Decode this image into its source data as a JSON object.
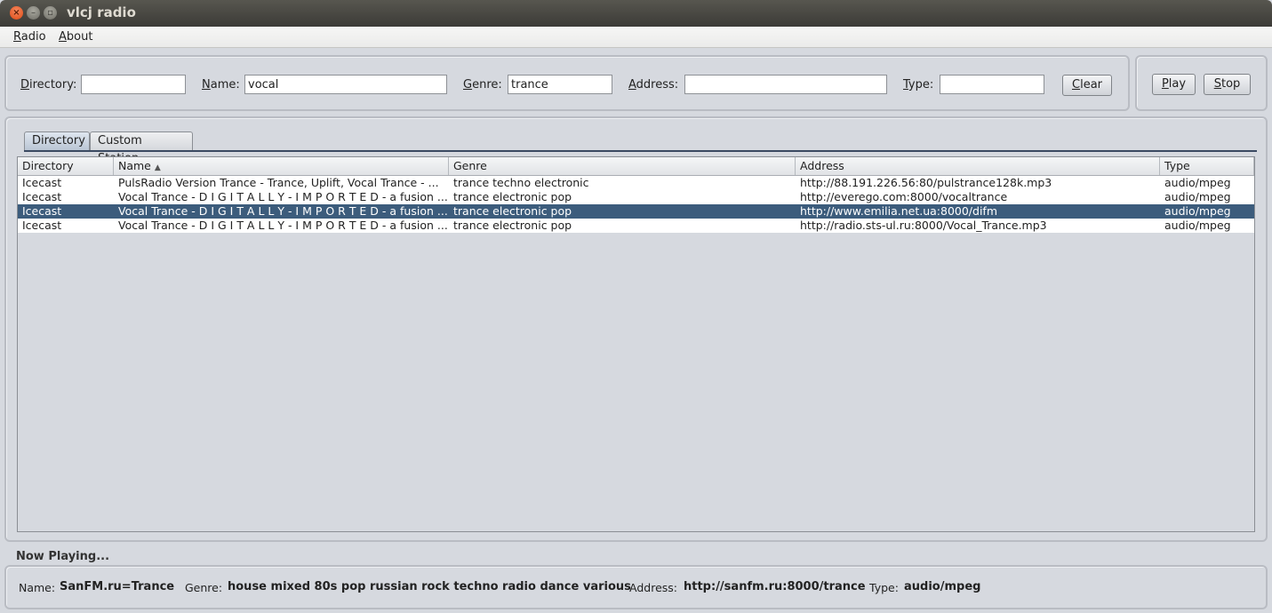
{
  "window": {
    "title": "vlcj radio",
    "close_glyph": "×",
    "min_glyph": "–",
    "max_glyph": "▫"
  },
  "menu": [
    {
      "mnemonic": "R",
      "rest": "adio"
    },
    {
      "mnemonic": "A",
      "rest": "bout"
    }
  ],
  "search": {
    "directory": {
      "mnemonic": "D",
      "rest": "irectory:",
      "value": ""
    },
    "name": {
      "mnemonic": "N",
      "rest": "ame:",
      "value": "vocal"
    },
    "genre": {
      "mnemonic": "G",
      "rest": "enre:",
      "value": "trance"
    },
    "address": {
      "mnemonic": "A",
      "rest": "ddress:",
      "value": ""
    },
    "type": {
      "mnemonic": "T",
      "rest": "ype:",
      "value": ""
    },
    "clear": {
      "mnemonic": "C",
      "rest": "lear"
    }
  },
  "controls": {
    "play": {
      "mnemonic": "P",
      "rest": "lay"
    },
    "stop": {
      "mnemonic": "S",
      "rest": "top"
    }
  },
  "tabs": [
    {
      "label": "Directory",
      "active": true
    },
    {
      "label": "Custom Station",
      "active": false
    }
  ],
  "table": {
    "columns": [
      "Directory",
      "Name",
      "Genre",
      "Address",
      "Type"
    ],
    "sort_indicator": "▲",
    "rows": [
      {
        "directory": "Icecast",
        "name": "PulsRadio Version Trance - Trance, Uplift, Vocal Trance - ...",
        "genre": "trance techno electronic",
        "address": "http://88.191.226.56:80/pulstrance128k.mp3",
        "type": "audio/mpeg",
        "selected": false
      },
      {
        "directory": "Icecast",
        "name": "Vocal Trance - D I G I T A L L Y - I M P O R T E D - a fusion ...",
        "genre": "trance electronic pop",
        "address": "http://everego.com:8000/vocaltrance",
        "type": "audio/mpeg",
        "selected": false
      },
      {
        "directory": "Icecast",
        "name": "Vocal Trance - D I G I T A L L Y - I M P O R T E D - a fusion ...",
        "genre": "trance electronic pop",
        "address": "http://www.emilia.net.ua:8000/difm",
        "type": "audio/mpeg",
        "selected": true
      },
      {
        "directory": "Icecast",
        "name": "Vocal Trance - D I G I T A L L Y - I M P O R T E D - a fusion ...",
        "genre": "trance electronic pop",
        "address": "http://radio.sts-ul.ru:8000/Vocal_Trance.mp3",
        "type": "audio/mpeg",
        "selected": false
      }
    ]
  },
  "now_playing": {
    "label": "Now Playing...",
    "name_label": "Name:",
    "name": "SanFM.ru=Trance",
    "genre_label": "Genre:",
    "genre": "house mixed 80s pop russian rock techno radio dance various",
    "address_label": "Address:",
    "address": "http://sanfm.ru:8000/trance",
    "type_label": "Type:",
    "type": "audio/mpeg"
  }
}
